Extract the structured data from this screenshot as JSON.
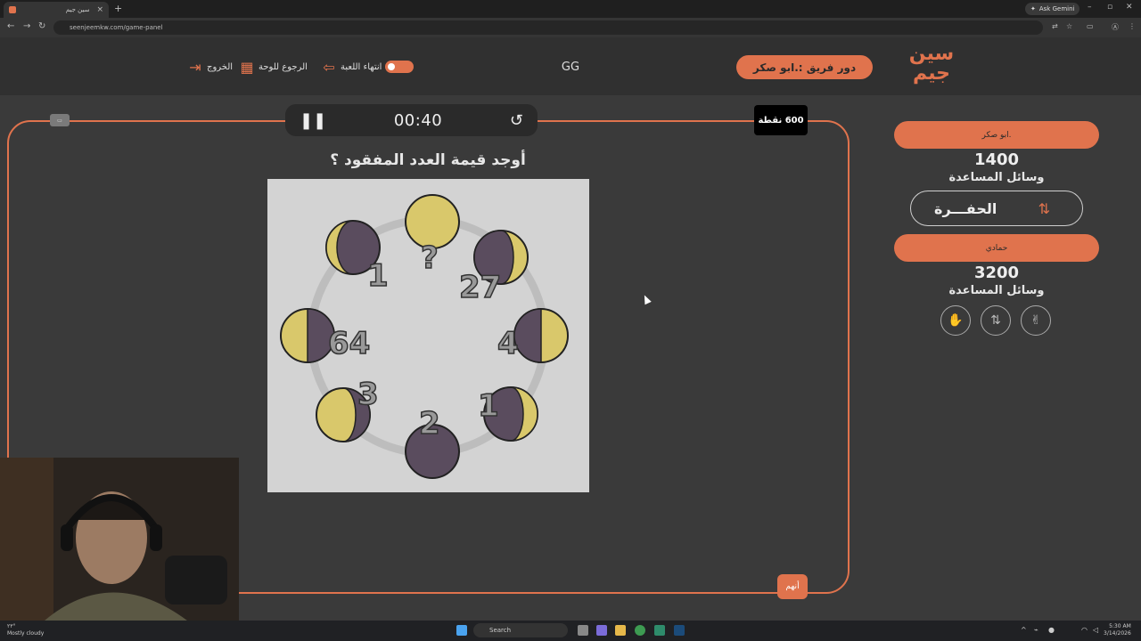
{
  "browser": {
    "tab_title": "سين جيم",
    "url": "seenjeemkw.com/game-panel",
    "ask_gemini": "Ask Gemini"
  },
  "header": {
    "logo_text": "سين جيم",
    "turn_label": "دور فريق :.ابو صكر",
    "center_text": "GG",
    "end_game": "انتهاء اللعبة",
    "back_to_board": "الرجوع للوحة",
    "exit": "الخروج"
  },
  "game": {
    "timer": "00:40",
    "points": "600 نقطة",
    "question": "أوجد قيمة العدد المفقود ؟",
    "answer_button": "أنهم",
    "puzzle_numbers": [
      "?",
      "27",
      "4",
      "1",
      "2",
      "3",
      "64",
      "1"
    ]
  },
  "teams": [
    {
      "name": ".ابو صكر",
      "score": "1400",
      "aids_label": "وسائل المساعدة",
      "active_aid": "الحفـــرة"
    },
    {
      "name": "حمادي",
      "score": "3200",
      "aids_label": "وسائل المساعدة",
      "aid_icons": [
        "hand-stop-icon",
        "swap-icon",
        "two-fingers-icon"
      ]
    }
  ],
  "taskbar": {
    "weather_temp": "٢٣°",
    "weather_text": "Mostly cloudy",
    "search": "Search",
    "time": "5:30 AM",
    "date": "3/14/2026"
  },
  "colors": {
    "accent": "#e0734d",
    "background": "#3a3a3a",
    "moon_light": "#d9c86b",
    "moon_dark": "#5a4c5e"
  }
}
